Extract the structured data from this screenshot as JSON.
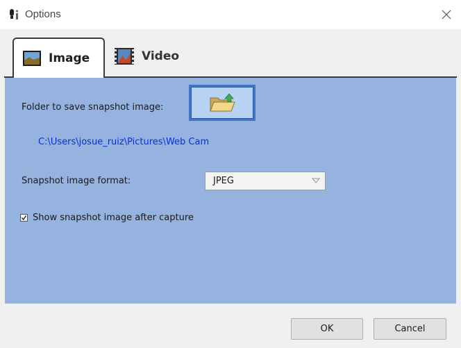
{
  "window": {
    "title": "Options"
  },
  "tabs": [
    {
      "label": "Image",
      "icon": "image-icon",
      "active": true
    },
    {
      "label": "Video",
      "icon": "film-icon",
      "active": false
    }
  ],
  "image_tab": {
    "folder_label": "Folder to save snapshot image:",
    "folder_button_icon": "folder-upload-icon",
    "folder_path": "C:\\Users\\josue_ruiz\\Pictures\\Web Cam",
    "format_label": "Snapshot image format:",
    "format_selected": "JPEG",
    "show_after_capture_label": "Show snapshot image after capture",
    "show_after_capture_checked": true
  },
  "buttons": {
    "ok": "OK",
    "cancel": "Cancel"
  },
  "colors": {
    "panel": "#95b3de",
    "path_text": "#0b2fd6",
    "folder_button_border": "#3f74c7"
  }
}
